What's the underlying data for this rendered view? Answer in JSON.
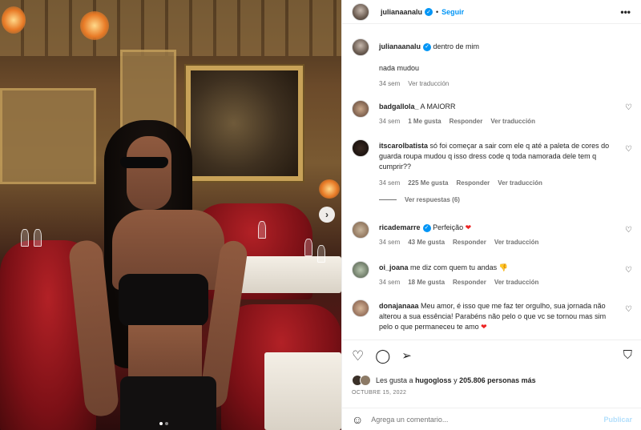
{
  "post": {
    "author": "julianaanalu",
    "follow_label": "Seguir",
    "more_label": "•••",
    "caption_text": "dentro de mim",
    "caption_line2": "nada mudou",
    "caption_time": "34 sem",
    "caption_translate": "Ver traducción"
  },
  "comments": [
    {
      "user": "badgallola_",
      "text": "A MAIORR",
      "time": "34 sem",
      "likes": "1 Me gusta",
      "reply": "Responder",
      "translate": "Ver traducción"
    },
    {
      "user": "itscarolbatista",
      "text": "só foi começar a sair com ele q até a paleta de cores do guarda roupa mudou q isso dress code q toda namorada dele tem q cumprir??",
      "time": "34 sem",
      "likes": "225 Me gusta",
      "reply": "Responder",
      "translate": "Ver traducción",
      "view_replies": "Ver respuestas (6)"
    },
    {
      "user": "ricademarre",
      "text": "Perfeição",
      "time": "34 sem",
      "likes": "43 Me gusta",
      "reply": "Responder",
      "translate": "Ver traducción"
    },
    {
      "user": "oi_joana",
      "text": "me diz com quem tu andas",
      "time": "34 sem",
      "likes": "18 Me gusta",
      "reply": "Responder",
      "translate": "Ver traducción"
    },
    {
      "user": "donajanaaa",
      "text": "Meu amor, é isso que me faz ter orgulho, sua jornada não alterou a sua essência! Parabéns não pelo o que vc se tornou mas sim pelo o que permaneceu te amo"
    }
  ],
  "footer": {
    "likes_prefix": "Les gusta a",
    "likes_user": "hugogloss",
    "likes_mid": "y",
    "likes_count": "205.806 personas más",
    "date": "OCTUBRE 15, 2022",
    "comment_placeholder": "Agrega un comentario...",
    "publish_label": "Publicar"
  },
  "icons": {
    "like": "heart-icon",
    "comment": "comment-icon",
    "share": "share-icon",
    "save": "bookmark-icon",
    "emoji": "emoji-icon",
    "next": "chevron-right-icon"
  },
  "colors": {
    "accent": "#0095f6",
    "heart": "#ed2424",
    "muted": "#737373"
  }
}
